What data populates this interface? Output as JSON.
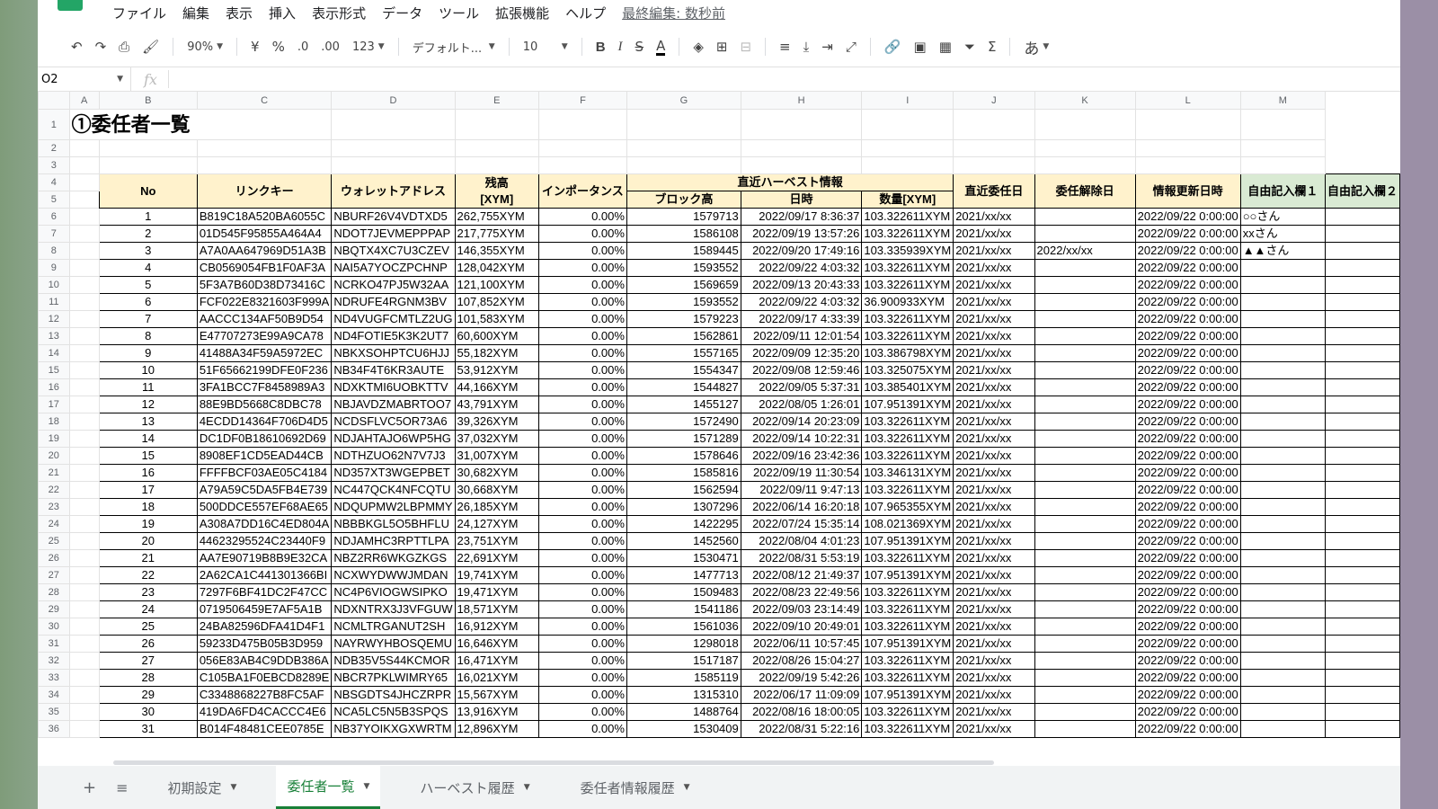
{
  "menu": {
    "items": [
      "ファイル",
      "編集",
      "表示",
      "挿入",
      "表示形式",
      "データ",
      "ツール",
      "拡張機能",
      "ヘルプ"
    ],
    "last_edit": "最終編集: 数秒前"
  },
  "toolbar": {
    "zoom": "90%",
    "currency": "¥",
    "percent": "%",
    "dec_decrease": ".0",
    "dec_increase": ".00",
    "number_format": "123",
    "font": "デフォルト...",
    "font_size": "10",
    "bold": "B",
    "italic": "I",
    "strike": "S",
    "text_color": "A",
    "input_tool": "あ"
  },
  "formula_bar": {
    "cell_ref": "O2",
    "fx": "fx",
    "value": ""
  },
  "columns": [
    "A",
    "B",
    "C",
    "D",
    "E",
    "F",
    "G",
    "H",
    "I",
    "J",
    "K",
    "L",
    "M"
  ],
  "sheet_title": "①委任者一覧",
  "headers": {
    "no": "No",
    "link_key": "リンクキー",
    "wallet": "ウォレットアドレス",
    "balance_l1": "残高",
    "balance_l2": "[XYM]",
    "importance": "インポータンス",
    "harvest_group": "直近ハーベスト情報",
    "block_height": "ブロック高",
    "datetime": "日時",
    "amount": "数量[XYM]",
    "recent_delegation": "直近委任日",
    "undelegation": "委任解除日",
    "info_updated": "情報更新日時",
    "free1": "自由記入欄１",
    "free2": "自由記入欄２"
  },
  "rows": [
    [
      "1",
      "B819C18A520BA6055C",
      "NBURF26V4VDTXD5",
      "262,755XYM",
      "0.00%",
      "1579713",
      "2022/09/17 8:36:37",
      "103.322611XYM",
      "2021/xx/xx",
      "",
      "2022/09/22 0:00:00",
      "○○さん",
      ""
    ],
    [
      "2",
      "01D545F95855A464A4",
      "NDOT7JEVMEPPPAP",
      "217,775XYM",
      "0.00%",
      "1586108",
      "2022/09/19 13:57:26",
      "103.322611XYM",
      "2021/xx/xx",
      "",
      "2022/09/22 0:00:00",
      "xxさん",
      ""
    ],
    [
      "3",
      "A7A0AA647969D51A3B",
      "NBQTX4XC7U3CZEV",
      "146,355XYM",
      "0.00%",
      "1589445",
      "2022/09/20 17:49:16",
      "103.335939XYM",
      "2021/xx/xx",
      "2022/xx/xx",
      "2022/09/22 0:00:00",
      "▲▲さん",
      ""
    ],
    [
      "4",
      "CB0569054FB1F0AF3A",
      "NAI5A7YOCZPCHNP",
      "128,042XYM",
      "0.00%",
      "1593552",
      "2022/09/22 4:03:32",
      "103.322611XYM",
      "2021/xx/xx",
      "",
      "2022/09/22 0:00:00",
      "",
      ""
    ],
    [
      "5",
      "5F3A7B60D38D73416C",
      "NCRKO47PJ5W32AA",
      "121,100XYM",
      "0.00%",
      "1569659",
      "2022/09/13 20:43:33",
      "103.322611XYM",
      "2021/xx/xx",
      "",
      "2022/09/22 0:00:00",
      "",
      ""
    ],
    [
      "6",
      "FCF022E8321603F999A",
      "NDRUFE4RGNM3BV",
      "107,852XYM",
      "0.00%",
      "1593552",
      "2022/09/22 4:03:32",
      "36.900933XYM",
      "2021/xx/xx",
      "",
      "2022/09/22 0:00:00",
      "",
      ""
    ],
    [
      "7",
      "AACCC134AF50B9D54",
      "ND4VUGFCMTLZ2UG",
      "101,583XYM",
      "0.00%",
      "1579223",
      "2022/09/17 4:33:39",
      "103.322611XYM",
      "2021/xx/xx",
      "",
      "2022/09/22 0:00:00",
      "",
      ""
    ],
    [
      "8",
      "E47707273E99A9CA78",
      "ND4FOTIE5K3K2UT7",
      "60,600XYM",
      "0.00%",
      "1562861",
      "2022/09/11 12:01:54",
      "103.322611XYM",
      "2021/xx/xx",
      "",
      "2022/09/22 0:00:00",
      "",
      ""
    ],
    [
      "9",
      "41488A34F59A5972EC",
      "NBKXSOHPTCU6HJJ",
      "55,182XYM",
      "0.00%",
      "1557165",
      "2022/09/09 12:35:20",
      "103.386798XYM",
      "2021/xx/xx",
      "",
      "2022/09/22 0:00:00",
      "",
      ""
    ],
    [
      "10",
      "51F65662199DFE0F236",
      "NB34F4T6KR3AUTE",
      "53,912XYM",
      "0.00%",
      "1554347",
      "2022/09/08 12:59:46",
      "103.325075XYM",
      "2021/xx/xx",
      "",
      "2022/09/22 0:00:00",
      "",
      ""
    ],
    [
      "11",
      "3FA1BCC7F8458989A3",
      "NDXKTMI6UOBKTTV",
      "44,166XYM",
      "0.00%",
      "1544827",
      "2022/09/05 5:37:31",
      "103.385401XYM",
      "2021/xx/xx",
      "",
      "2022/09/22 0:00:00",
      "",
      ""
    ],
    [
      "12",
      "88E9BD5668C8DBC78",
      "NBJAVDZMABRTOO7",
      "43,791XYM",
      "0.00%",
      "1455127",
      "2022/08/05 1:26:01",
      "107.951391XYM",
      "2021/xx/xx",
      "",
      "2022/09/22 0:00:00",
      "",
      ""
    ],
    [
      "13",
      "4ECDD14364F706D4D5",
      "NCDSFLVC5OR73A6",
      "39,326XYM",
      "0.00%",
      "1572490",
      "2022/09/14 20:23:09",
      "103.322611XYM",
      "2021/xx/xx",
      "",
      "2022/09/22 0:00:00",
      "",
      ""
    ],
    [
      "14",
      "DC1DF0B18610692D69",
      "NDJAHTAJO6WP5HG",
      "37,032XYM",
      "0.00%",
      "1571289",
      "2022/09/14 10:22:31",
      "103.322611XYM",
      "2021/xx/xx",
      "",
      "2022/09/22 0:00:00",
      "",
      ""
    ],
    [
      "15",
      "8908EF1CD5EAD44CB",
      "NDTHZUO62N7V7J3",
      "31,007XYM",
      "0.00%",
      "1578646",
      "2022/09/16 23:42:36",
      "103.322611XYM",
      "2021/xx/xx",
      "",
      "2022/09/22 0:00:00",
      "",
      ""
    ],
    [
      "16",
      "FFFFBCF03AE05C4184",
      "ND357XT3WGEPBET",
      "30,682XYM",
      "0.00%",
      "1585816",
      "2022/09/19 11:30:54",
      "103.346131XYM",
      "2021/xx/xx",
      "",
      "2022/09/22 0:00:00",
      "",
      ""
    ],
    [
      "17",
      "A79A59C5DA5FB4E739",
      "NC447QCK4NFCQTU",
      "30,668XYM",
      "0.00%",
      "1562594",
      "2022/09/11 9:47:13",
      "103.322611XYM",
      "2021/xx/xx",
      "",
      "2022/09/22 0:00:00",
      "",
      ""
    ],
    [
      "18",
      "500DDCE557EF68AE65",
      "NDQUPMW2LBPMMY",
      "26,185XYM",
      "0.00%",
      "1307296",
      "2022/06/14 16:20:18",
      "107.965355XYM",
      "2021/xx/xx",
      "",
      "2022/09/22 0:00:00",
      "",
      ""
    ],
    [
      "19",
      "A308A7DD16C4ED804A",
      "NBBBKGL5O5BHFLU",
      "24,127XYM",
      "0.00%",
      "1422295",
      "2022/07/24 15:35:14",
      "108.021369XYM",
      "2021/xx/xx",
      "",
      "2022/09/22 0:00:00",
      "",
      ""
    ],
    [
      "20",
      "44623295524C23440F9",
      "NDJAMHC3RPTTLPA",
      "23,751XYM",
      "0.00%",
      "1452560",
      "2022/08/04 4:01:23",
      "107.951391XYM",
      "2021/xx/xx",
      "",
      "2022/09/22 0:00:00",
      "",
      ""
    ],
    [
      "21",
      "AA7E90719B8B9E32CA",
      "NBZ2RR6WKGZKGS",
      "22,691XYM",
      "0.00%",
      "1530471",
      "2022/08/31 5:53:19",
      "103.322611XYM",
      "2021/xx/xx",
      "",
      "2022/09/22 0:00:00",
      "",
      ""
    ],
    [
      "22",
      "2A62CA1C441301366BI",
      "NCXWYDWWJMDAN",
      "19,741XYM",
      "0.00%",
      "1477713",
      "2022/08/12 21:49:37",
      "107.951391XYM",
      "2021/xx/xx",
      "",
      "2022/09/22 0:00:00",
      "",
      ""
    ],
    [
      "23",
      "7297F6BF41DC2F47CC",
      "NC4P6VIOGWSIPKO",
      "19,471XYM",
      "0.00%",
      "1509483",
      "2022/08/23 22:49:56",
      "103.322611XYM",
      "2021/xx/xx",
      "",
      "2022/09/22 0:00:00",
      "",
      ""
    ],
    [
      "24",
      "0719506459E7AF5A1B",
      "NDXNTRX3J3VFGUW",
      "18,571XYM",
      "0.00%",
      "1541186",
      "2022/09/03 23:14:49",
      "103.322611XYM",
      "2021/xx/xx",
      "",
      "2022/09/22 0:00:00",
      "",
      ""
    ],
    [
      "25",
      "24BA82596DFA41D4F1",
      "NCMLTRGANUT2SH",
      "16,912XYM",
      "0.00%",
      "1561036",
      "2022/09/10 20:49:01",
      "103.322611XYM",
      "2021/xx/xx",
      "",
      "2022/09/22 0:00:00",
      "",
      ""
    ],
    [
      "26",
      "59233D475B05B3D959",
      "NAYRWYHBOSQEMU",
      "16,646XYM",
      "0.00%",
      "1298018",
      "2022/06/11 10:57:45",
      "107.951391XYM",
      "2021/xx/xx",
      "",
      "2022/09/22 0:00:00",
      "",
      ""
    ],
    [
      "27",
      "056E83AB4C9DDB386A",
      "NDB35V5S44KCMOR",
      "16,471XYM",
      "0.00%",
      "1517187",
      "2022/08/26 15:04:27",
      "103.322611XYM",
      "2021/xx/xx",
      "",
      "2022/09/22 0:00:00",
      "",
      ""
    ],
    [
      "28",
      "C105BA1F0EBCD8289E",
      "NBCR7PKLWIMRY65",
      "16,021XYM",
      "0.00%",
      "1585119",
      "2022/09/19 5:42:26",
      "103.322611XYM",
      "2021/xx/xx",
      "",
      "2022/09/22 0:00:00",
      "",
      ""
    ],
    [
      "29",
      "C3348868227B8FC5AF",
      "NBSGDTS4JHCZRPR",
      "15,567XYM",
      "0.00%",
      "1315310",
      "2022/06/17 11:09:09",
      "107.951391XYM",
      "2021/xx/xx",
      "",
      "2022/09/22 0:00:00",
      "",
      ""
    ],
    [
      "30",
      "419DA6FD4CACCC4E6",
      "NCA5LC5N5B3SPQS",
      "13,916XYM",
      "0.00%",
      "1488764",
      "2022/08/16 18:00:05",
      "103.322611XYM",
      "2021/xx/xx",
      "",
      "2022/09/22 0:00:00",
      "",
      ""
    ],
    [
      "31",
      "B014F48481CEE0785E",
      "NB37YOIKXGXWRTM",
      "12,896XYM",
      "0.00%",
      "1530409",
      "2022/08/31 5:22:16",
      "103.322611XYM",
      "2021/xx/xx",
      "",
      "2022/09/22 0:00:00",
      "",
      ""
    ]
  ],
  "sheet_tabs": {
    "add": "+",
    "list": "≡",
    "tabs": [
      "初期設定",
      "委任者一覧",
      "ハーベスト履歴",
      "委任者情報履歴"
    ],
    "active_index": 1
  }
}
